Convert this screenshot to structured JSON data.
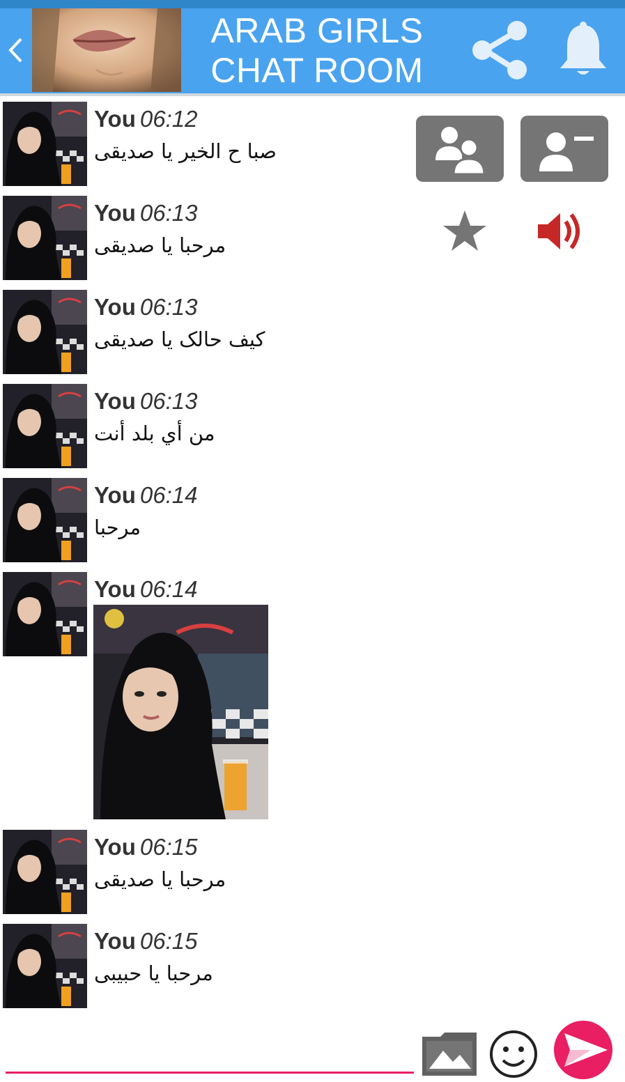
{
  "header": {
    "title_line1": "ARAB GIRLS",
    "title_line2": "CHAT ROOM",
    "color": "#4aa3ee",
    "back_icon": "chevron-left-icon",
    "share_icon": "share-icon",
    "bell_icon": "bell-icon"
  },
  "tools": {
    "group_icon": "users-icon",
    "contact_icon": "contact-card-icon",
    "star_icon": "star-icon",
    "speaker_icon": "speaker-icon",
    "speaker_color": "#c62828"
  },
  "messages": [
    {
      "sender": "You",
      "time": "06:12",
      "text": "صبا ح الخير يا صديقى"
    },
    {
      "sender": "You",
      "time": "06:13",
      "text": "مرحبا يا صديقى"
    },
    {
      "sender": "You",
      "time": "06:13",
      "text": "كيف حالک يا صديقى"
    },
    {
      "sender": "You",
      "time": "06:13",
      "text": "من أي بلد أنت"
    },
    {
      "sender": "You",
      "time": "06:14",
      "text": "مرحبا"
    },
    {
      "sender": "You",
      "time": "06:14",
      "text": ""
    },
    {
      "sender": "You",
      "time": "06:15",
      "text": "مرحبا يا صديقى"
    },
    {
      "sender": "You",
      "time": "06:15",
      "text": "مرحبا يا حبيبى"
    }
  ],
  "composer": {
    "placeholder": "",
    "value": "",
    "accent": "#e91e63",
    "gallery_icon": "image-gallery-icon",
    "emoji_icon": "smiley-icon",
    "send_icon": "send-icon"
  }
}
